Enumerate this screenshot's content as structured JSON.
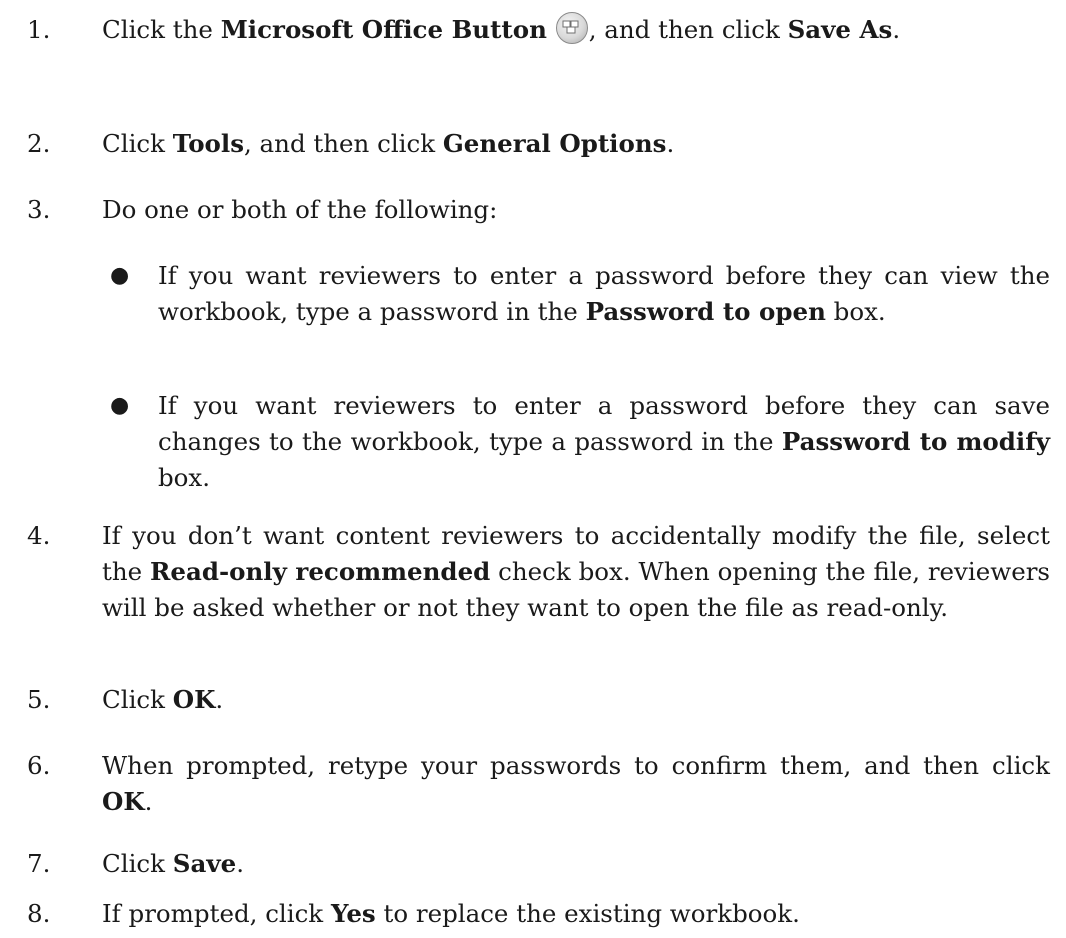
{
  "steps": [
    {
      "num": "1.",
      "parts": [
        {
          "t": "Click the "
        },
        {
          "b": "Microsoft Office Button"
        },
        {
          "icon": "office-button-icon"
        },
        {
          "t": ", and then click "
        },
        {
          "b": "Save As"
        },
        {
          "t": "."
        }
      ]
    },
    {
      "num": "2.",
      "parts": [
        {
          "t": "Click "
        },
        {
          "b": "Tools"
        },
        {
          "t": ", and then click "
        },
        {
          "b": "General Options"
        },
        {
          "t": "."
        }
      ]
    },
    {
      "num": "3.",
      "parts": [
        {
          "t": "Do one or both of the following:"
        }
      ]
    },
    {
      "num": "4.",
      "parts": [
        {
          "t": "If you don’t want content reviewers to accidentally modify the file, select the "
        },
        {
          "b": "Read-only recommended"
        },
        {
          "t": " check box. When opening the file, reviewers will be asked whether or not they want to open the file as read-only."
        }
      ]
    },
    {
      "num": "5.",
      "parts": [
        {
          "t": "Click "
        },
        {
          "b": "OK"
        },
        {
          "t": "."
        }
      ]
    },
    {
      "num": "6.",
      "parts": [
        {
          "t": "When prompted, retype your passwords to confirm them, and then click "
        },
        {
          "b": "OK"
        },
        {
          "t": "."
        }
      ]
    },
    {
      "num": "7.",
      "parts": [
        {
          "t": "Click "
        },
        {
          "b": "Save"
        },
        {
          "t": "."
        }
      ]
    },
    {
      "num": "8.",
      "parts": [
        {
          "t": "If prompted, click "
        },
        {
          "b": "Yes"
        },
        {
          "t": " to replace the existing workbook."
        }
      ]
    }
  ],
  "bullets": [
    {
      "symbol": "●",
      "parts": [
        {
          "t": "If you want reviewers to enter a password before they can view the workbook, type a password in the "
        },
        {
          "b": "Password to open"
        },
        {
          "t": " box."
        }
      ]
    },
    {
      "symbol": "●",
      "parts": [
        {
          "t": "If you want reviewers to enter a password before they can save changes to the workbook, type a password in the "
        },
        {
          "b": "Password to modify"
        },
        {
          "t": " box."
        }
      ]
    }
  ]
}
